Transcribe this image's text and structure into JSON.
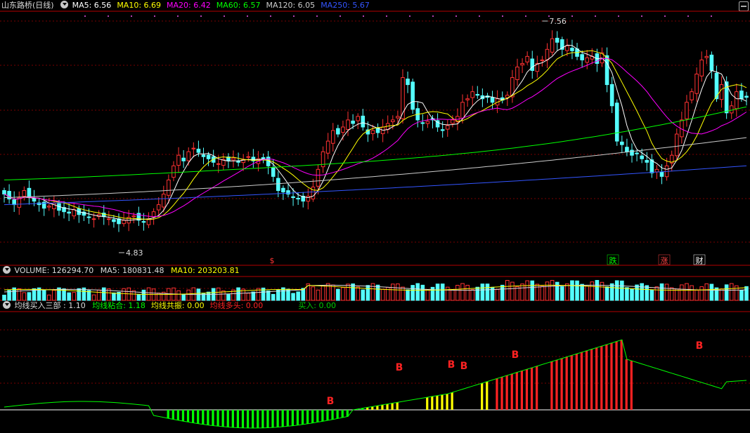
{
  "main": {
    "title": "山东路桥(日线)",
    "ma": [
      {
        "label": "MA5: 6.56",
        "color": "#ffffff"
      },
      {
        "label": "MA10: 6.69",
        "color": "#ffff00"
      },
      {
        "label": "MA20: 6.42",
        "color": "#ff00ff"
      },
      {
        "label": "MA60: 6.57",
        "color": "#00ff00"
      },
      {
        "label": "MA120: 6.05",
        "color": "#cccccc"
      },
      {
        "label": "MA250: 5.67",
        "color": "#3355ff"
      }
    ],
    "high_label": "7.56",
    "low_label": "4.83",
    "markers": [
      {
        "text": "$",
        "color": "#ff3333"
      },
      {
        "text": "跌",
        "color": "#00ff00"
      },
      {
        "text": "涨",
        "color": "#ff4444"
      },
      {
        "text": "财",
        "color": "#ffffff"
      }
    ]
  },
  "volume": {
    "label": "VOLUME: 126294.70",
    "ma5": "MA5: 180831.48",
    "ma10": "MA10: 203203.81"
  },
  "indicator": {
    "name": "均线买入三部 : 1.10",
    "items": [
      {
        "label": "均线粘合: 1.18",
        "color": "#00ff00"
      },
      {
        "label": "均线共振: 0.00",
        "color": "#ffff00"
      },
      {
        "label": "均线多头: 0.00",
        "color": "#ff2222"
      },
      {
        "label": "买入: 0.00",
        "color": "#00cc00"
      }
    ],
    "signal": "B"
  },
  "colors": {
    "up": "#ff3232",
    "down": "#54ffff",
    "grid": "#7a0000",
    "border": "#b40000"
  },
  "chart_data": {
    "type": "candlestick",
    "price_ylim": [
      4.5,
      7.8
    ],
    "bars": 160,
    "close": [
      5.25,
      5.18,
      5.1,
      5.2,
      5.3,
      5.22,
      5.15,
      5.1,
      5.05,
      5.08,
      5.12,
      5.02,
      5.0,
      4.98,
      5.03,
      4.96,
      4.95,
      4.92,
      4.9,
      4.96,
      4.93,
      4.9,
      4.86,
      4.83,
      4.88,
      4.92,
      4.94,
      4.88,
      4.85,
      4.9,
      5.0,
      5.1,
      5.25,
      5.45,
      5.65,
      5.8,
      5.72,
      5.85,
      5.9,
      5.84,
      5.78,
      5.75,
      5.7,
      5.68,
      5.74,
      5.72,
      5.76,
      5.7,
      5.74,
      5.78,
      5.72,
      5.75,
      5.74,
      5.65,
      5.5,
      5.3,
      5.28,
      5.25,
      5.2,
      5.18,
      5.15,
      5.22,
      5.35,
      5.6,
      5.85,
      6.0,
      6.15,
      6.1,
      6.2,
      6.3,
      6.25,
      6.35,
      6.2,
      6.1,
      6.15,
      6.12,
      6.2,
      6.25,
      6.3,
      6.35,
      6.9,
      6.8,
      6.45,
      6.3,
      6.25,
      6.28,
      6.3,
      6.2,
      6.15,
      6.22,
      6.3,
      6.35,
      6.55,
      6.6,
      6.7,
      6.65,
      6.6,
      6.62,
      6.55,
      6.6,
      6.58,
      6.65,
      6.9,
      7.05,
      7.1,
      7.2,
      7.0,
      7.1,
      7.15,
      7.3,
      7.45,
      7.4,
      7.3,
      7.35,
      7.28,
      7.2,
      7.15,
      7.18,
      7.2,
      7.1,
      7.25,
      6.8,
      6.5,
      6.0,
      5.95,
      5.85,
      5.8,
      5.82,
      5.75,
      5.7,
      5.55,
      5.6,
      5.5,
      5.65,
      5.8,
      6.1,
      6.3,
      6.55,
      6.7,
      6.95,
      7.15,
      7.2,
      7.0,
      6.6,
      6.8,
      6.4,
      6.5,
      6.7,
      6.6,
      6.62
    ]
  }
}
